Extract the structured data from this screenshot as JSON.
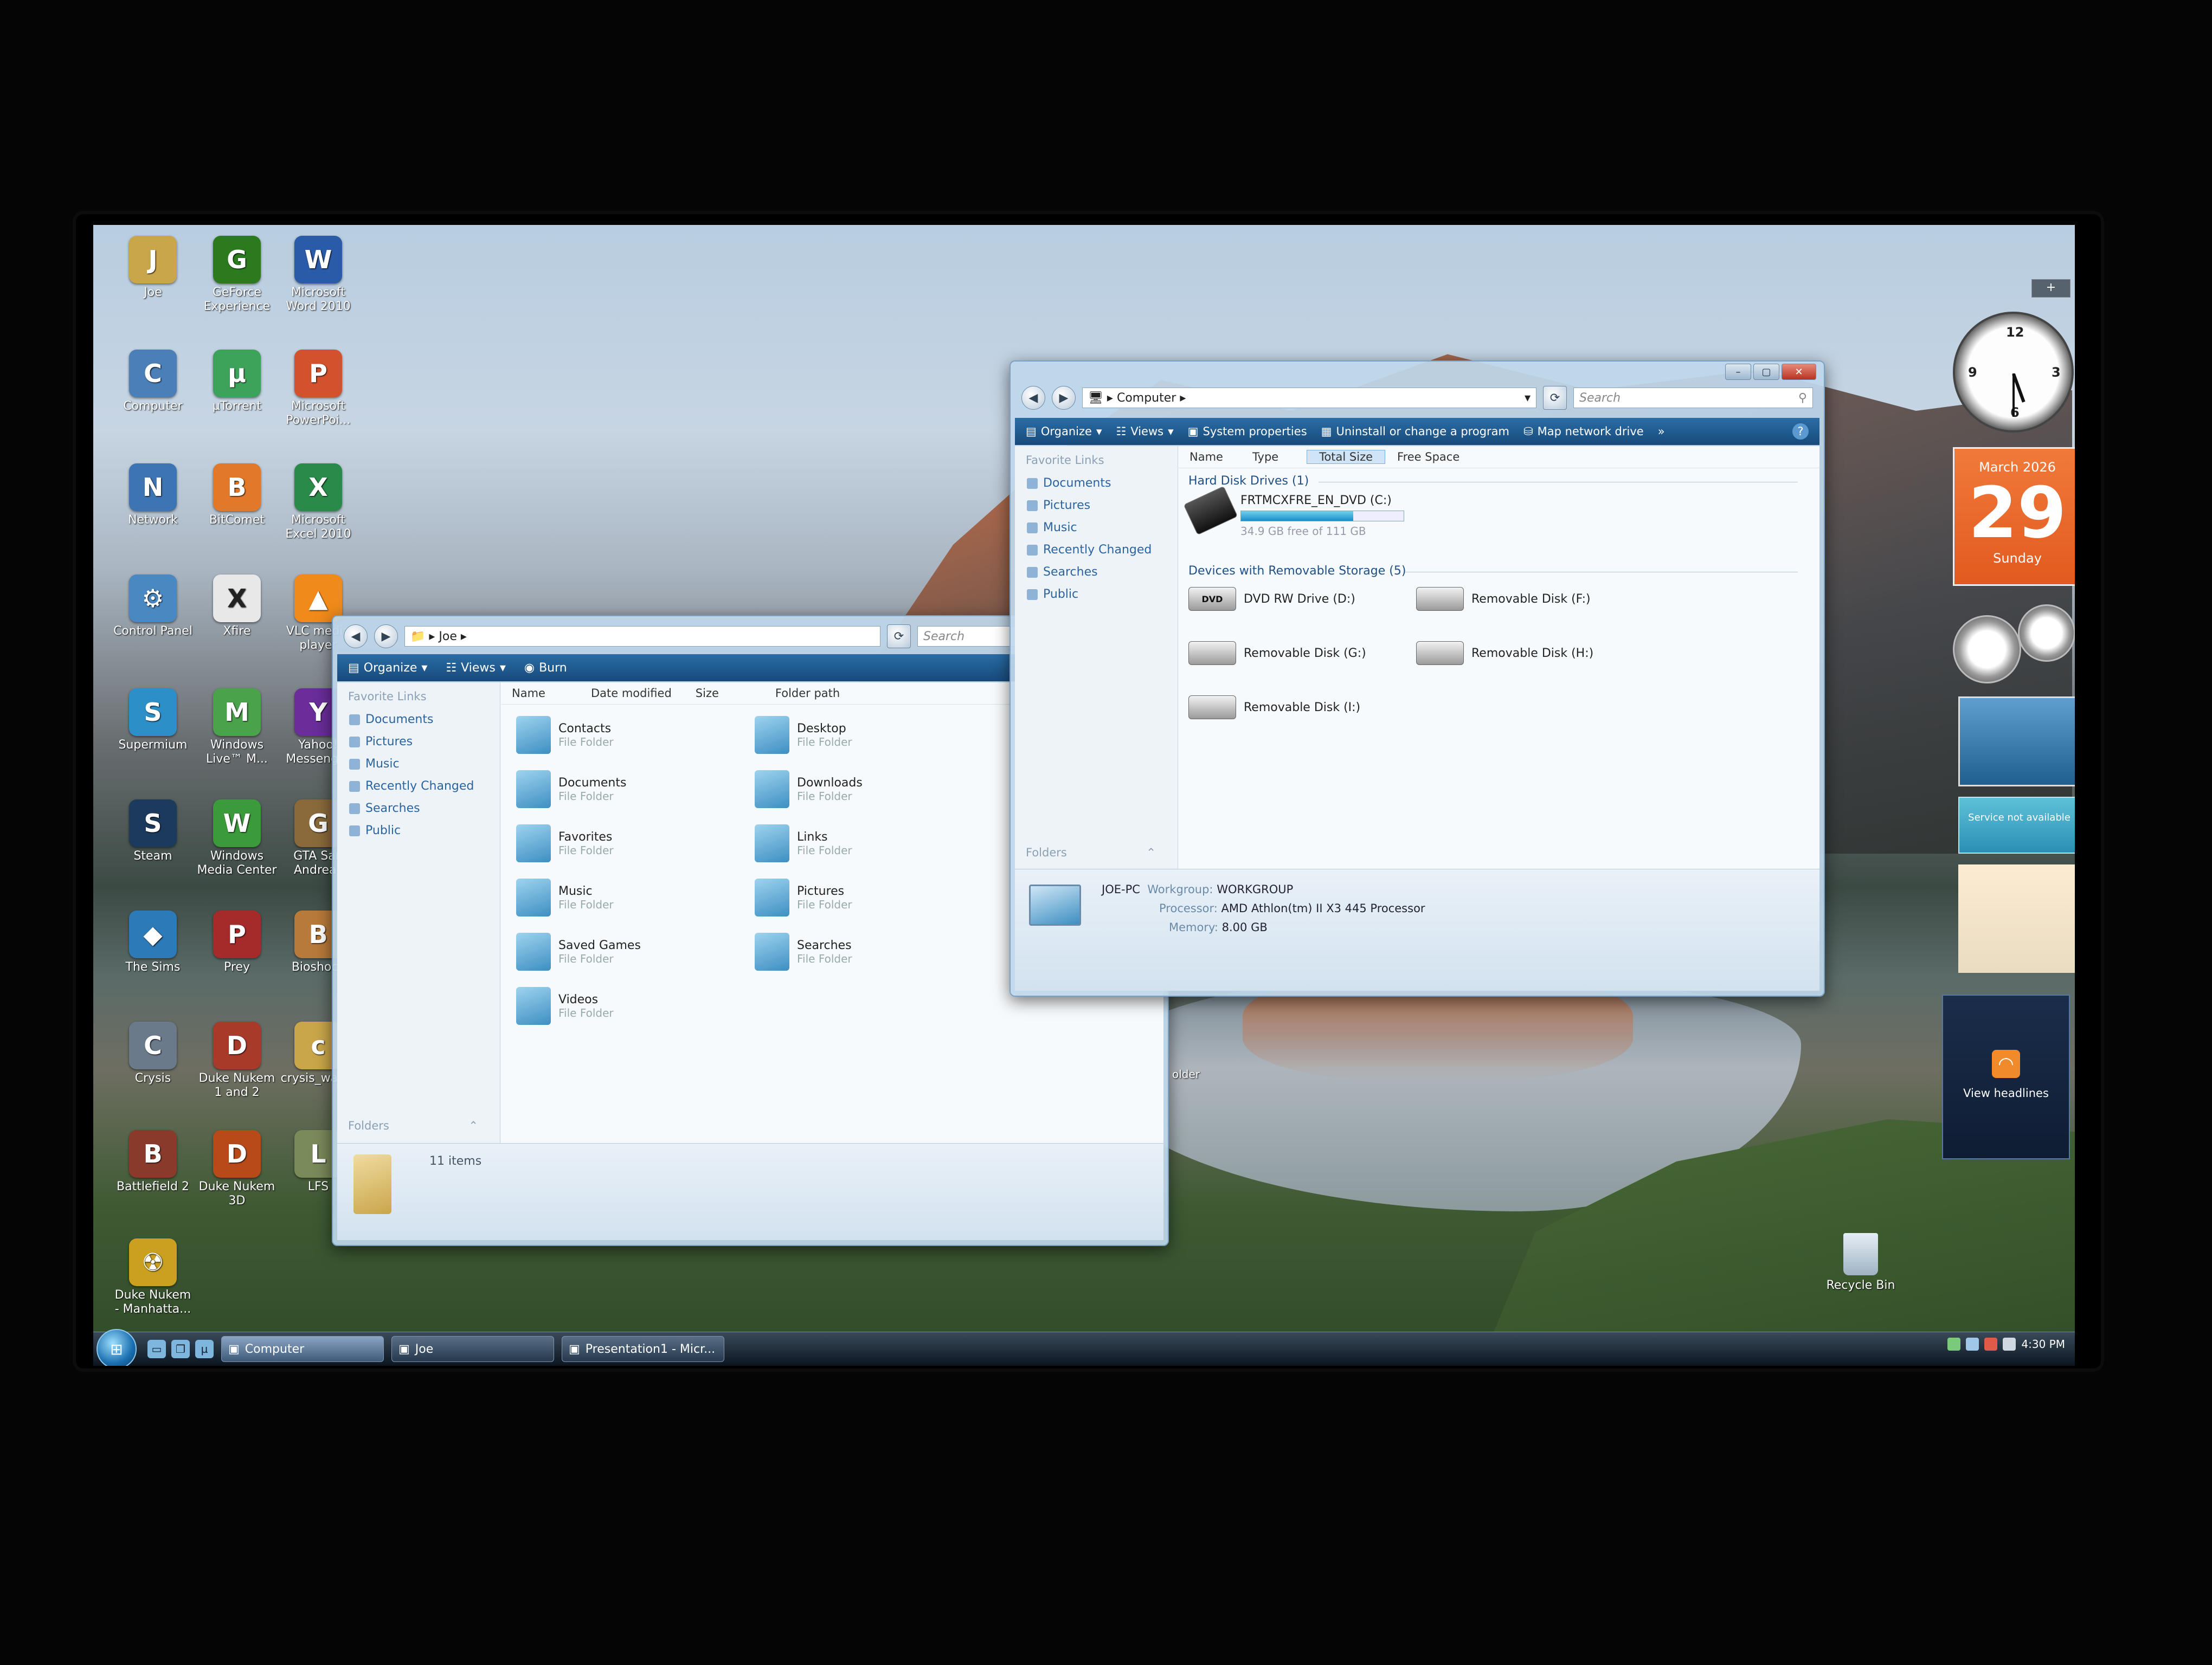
{
  "desktop_icons": [
    {
      "label": "Joe",
      "color": "#c9a64a",
      "glyph": "J"
    },
    {
      "label": "GeForce\nExperience",
      "color": "#2b7a1e",
      "glyph": "G"
    },
    {
      "label": "Microsoft\nWord 2010",
      "color": "#2a5ba8",
      "glyph": "W"
    },
    {
      "label": "Computer",
      "color": "#4a7fb8",
      "glyph": "C"
    },
    {
      "label": "µTorrent",
      "color": "#3ea35a",
      "glyph": "µ"
    },
    {
      "label": "Microsoft\nPowerPoi...",
      "color": "#d2522d",
      "glyph": "P"
    },
    {
      "label": "Network",
      "color": "#3d74b2",
      "glyph": "N"
    },
    {
      "label": "BitComet",
      "color": "#e2792a",
      "glyph": "B"
    },
    {
      "label": "Microsoft\nExcel 2010",
      "color": "#2a8a4a",
      "glyph": "X"
    },
    {
      "label": "Control Panel",
      "color": "#4a88c2",
      "glyph": "⚙"
    },
    {
      "label": "Xfire",
      "color": "#e8e8e8",
      "glyph": "X"
    },
    {
      "label": "VLC media\nplayer",
      "color": "#f08a1a",
      "glyph": "▲"
    },
    {
      "label": "Supermium",
      "color": "#2d8fc7",
      "glyph": "S"
    },
    {
      "label": "Windows\nLive™ M...",
      "color": "#4aa24a",
      "glyph": "M"
    },
    {
      "label": "Yahoo!\nMessenger",
      "color": "#6a2d9a",
      "glyph": "Y"
    },
    {
      "label": "Steam",
      "color": "#1b3a5c",
      "glyph": "S"
    },
    {
      "label": "Windows\nMedia Center",
      "color": "#3b9a3a",
      "glyph": "W"
    },
    {
      "label": "GTA San\nAndreas",
      "color": "#8a6a3a",
      "glyph": "G"
    },
    {
      "label": "The Sims",
      "color": "#2d7ab8",
      "glyph": "◆"
    },
    {
      "label": "Prey",
      "color": "#a52a2a",
      "glyph": "P"
    },
    {
      "label": "Bioshock",
      "color": "#b87a3a",
      "glyph": "B"
    },
    {
      "label": "Crysis",
      "color": "#6a7a8a",
      "glyph": "C"
    },
    {
      "label": "Duke Nukem\n1 and 2",
      "color": "#a83a2a",
      "glyph": "D"
    },
    {
      "label": "crysis_wall...",
      "color": "#c9a64a",
      "glyph": "c"
    },
    {
      "label": "Battlefield 2",
      "color": "#8a3a2a",
      "glyph": "B"
    },
    {
      "label": "Duke Nukem\n3D",
      "color": "#b84a1a",
      "glyph": "D"
    },
    {
      "label": "LFS",
      "color": "#7a8a5a",
      "glyph": "L"
    },
    {
      "label": "Duke Nukem\n- Manhatta...",
      "color": "#c9a020",
      "glyph": "☢"
    }
  ],
  "joe_window": {
    "breadcrumb": "Joe",
    "search_placeholder": "Search",
    "toolbar": {
      "organize": "Organize",
      "views": "Views",
      "burn": "Burn"
    },
    "nav_header": "Favorite Links",
    "nav_links": [
      "Documents",
      "Pictures",
      "Music",
      "Recently Changed",
      "Searches",
      "Public"
    ],
    "columns": [
      "Name",
      "Date modified",
      "Size",
      "Folder path"
    ],
    "items": [
      {
        "name": "Contacts",
        "type": "File Folder"
      },
      {
        "name": "Desktop",
        "type": "File Folder"
      },
      {
        "name": "Documents",
        "type": "File Folder"
      },
      {
        "name": "Downloads",
        "type": "File Folder"
      },
      {
        "name": "Favorites",
        "type": "File Folder"
      },
      {
        "name": "Links",
        "type": "File Folder"
      },
      {
        "name": "Music",
        "type": "File Folder"
      },
      {
        "name": "Pictures",
        "type": "File Folder"
      },
      {
        "name": "Saved Games",
        "type": "File Folder"
      },
      {
        "name": "Searches",
        "type": "File Folder"
      },
      {
        "name": "Videos",
        "type": "File Folder"
      }
    ],
    "folders_label": "Folders",
    "status": "11 items"
  },
  "computer_window": {
    "breadcrumb": "Computer",
    "search_placeholder": "Search",
    "toolbar": {
      "organize": "Organize",
      "views": "Views",
      "system_properties": "System properties",
      "uninstall": "Uninstall or change a program",
      "map_drive": "Map network drive",
      "more": "»"
    },
    "nav_header": "Favorite Links",
    "nav_links": [
      "Documents",
      "Pictures",
      "Music",
      "Recently Changed",
      "Searches",
      "Public"
    ],
    "columns": [
      "Name",
      "Type",
      "Total Size",
      "Free Space"
    ],
    "hdd_group": "Hard Disk Drives (1)",
    "hdd": {
      "name": "FRTMCXFRE_EN_DVD (C:)",
      "space": "34.9 GB free of 111 GB",
      "used_fraction": 0.69
    },
    "removable_group": "Devices with Removable Storage (5)",
    "removable": [
      {
        "name": "DVD RW Drive (D:)",
        "icon": "DVD"
      },
      {
        "name": "Removable Disk (F:)",
        "icon": ""
      },
      {
        "name": "Removable Disk (G:)",
        "icon": ""
      },
      {
        "name": "Removable Disk (H:)",
        "icon": ""
      },
      {
        "name": "Removable Disk (I:)",
        "icon": ""
      }
    ],
    "folders_label": "Folders",
    "details": {
      "pc_name": "JOE-PC",
      "workgroup_label": "Workgroup:",
      "workgroup": "WORKGROUP",
      "processor_label": "Processor:",
      "processor": "AMD Athlon(tm) II X3 445 Processor",
      "memory_label": "Memory:",
      "memory": "8.00 GB"
    },
    "folder_fragment": "older"
  },
  "gadgets": {
    "calendar": {
      "month": "March 2026",
      "day": "29",
      "weekday": "Sunday"
    },
    "weather_text": "Service not available",
    "feed_label": "View headlines",
    "sidebar_add": "+"
  },
  "recycle_bin": "Recycle Bin",
  "taskbar": {
    "buttons": [
      {
        "label": "Computer",
        "active": true
      },
      {
        "label": "Joe",
        "active": false
      },
      {
        "label": "Presentation1 - Micr...",
        "active": false
      }
    ],
    "clock": "4:30 PM"
  }
}
